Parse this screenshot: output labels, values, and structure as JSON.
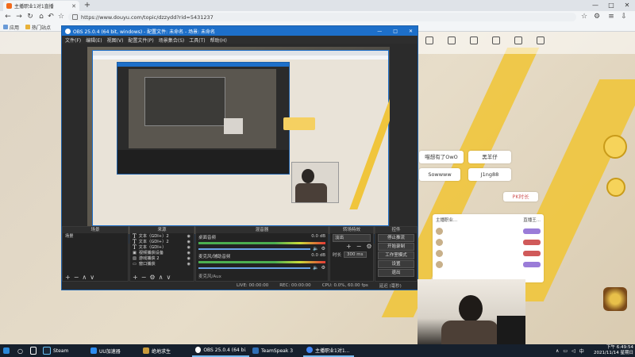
{
  "browser": {
    "tab_title": "主播职业1对1直播",
    "url": "https://www.douyu.com/topic/dzzydd?rid=5431237",
    "bookmarks": [
      "应用",
      "热门站点"
    ],
    "window_controls": [
      "—",
      "□",
      "✕"
    ]
  },
  "site": {
    "nav_items": [
      "",
      "",
      "",
      "",
      "",
      "",
      "",
      "",
      ""
    ],
    "pills": [
      "喵想有了OwO",
      "黑羊仔",
      "Sowwww",
      "J1ng88"
    ],
    "side_link": "PK时长",
    "list_header_left": "主播职业...",
    "list_header_right": "直播王..."
  },
  "obs": {
    "title": "OBS 25.0.4 (64 bit, windows) - 配置文件: 未命名 - 场景: 未命名",
    "menu": [
      "文件(F)",
      "编辑(E)",
      "视图(V)",
      "配置文件(P)",
      "场景集合(S)",
      "工具(T)",
      "帮助(H)"
    ],
    "panels": {
      "scenes": {
        "header": "场景",
        "items": [
          "场景"
        ]
      },
      "sources": {
        "header": "来源",
        "items": [
          "文本（GDI+）2",
          "文本（GDI+）2",
          "文本（GDI+）",
          "视频捕获设备",
          "游戏捕获 2",
          "窗口捕获"
        ]
      },
      "mixer": {
        "header": "混音器",
        "tracks": [
          {
            "name": "桌面音频",
            "db": "0.0 dB"
          },
          {
            "name": "麦克风/辅助音频",
            "db": "0.0 dB"
          }
        ],
        "extra": "麦克风/Aux"
      },
      "transitions": {
        "header": "转场特效",
        "type": "淡出",
        "duration_label": "时长",
        "duration": "300 ms"
      },
      "controls": {
        "header": "控件",
        "buttons": [
          "停止推流",
          "开始录制",
          "工作室模式",
          "设置",
          "退出"
        ]
      }
    },
    "status": {
      "live": "LIVE: 00:00:00",
      "rec": "REC: 00:00:00",
      "cpu": "CPU: 0.0%, 60.00 fps",
      "extra": "延迟 (毫秒)"
    }
  },
  "taskbar": {
    "items": [
      "Steam",
      "UU加速器",
      "绝地求生",
      "OBS 25.0.4 (64 bi...",
      "TeamSpeak 3",
      "主播职业1对1..."
    ],
    "clock_time": "下午 6:49:54",
    "clock_date": "2021/11/14 星期日"
  },
  "colors": {
    "accent": "#1d6fc9",
    "taskbar": "#16202d",
    "stripe": "#f0c53c"
  }
}
